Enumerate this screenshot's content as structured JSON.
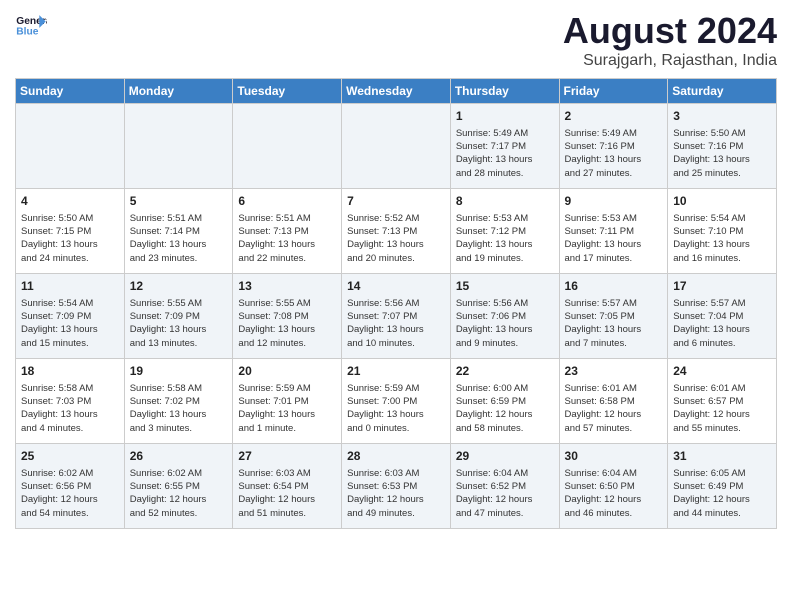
{
  "logo": {
    "line1": "General",
    "line2": "Blue"
  },
  "title": "August 2024",
  "subtitle": "Surajgarh, Rajasthan, India",
  "days_of_week": [
    "Sunday",
    "Monday",
    "Tuesday",
    "Wednesday",
    "Thursday",
    "Friday",
    "Saturday"
  ],
  "weeks": [
    [
      {
        "day": "",
        "info": ""
      },
      {
        "day": "",
        "info": ""
      },
      {
        "day": "",
        "info": ""
      },
      {
        "day": "",
        "info": ""
      },
      {
        "day": "1",
        "info": "Sunrise: 5:49 AM\nSunset: 7:17 PM\nDaylight: 13 hours\nand 28 minutes."
      },
      {
        "day": "2",
        "info": "Sunrise: 5:49 AM\nSunset: 7:16 PM\nDaylight: 13 hours\nand 27 minutes."
      },
      {
        "day": "3",
        "info": "Sunrise: 5:50 AM\nSunset: 7:16 PM\nDaylight: 13 hours\nand 25 minutes."
      }
    ],
    [
      {
        "day": "4",
        "info": "Sunrise: 5:50 AM\nSunset: 7:15 PM\nDaylight: 13 hours\nand 24 minutes."
      },
      {
        "day": "5",
        "info": "Sunrise: 5:51 AM\nSunset: 7:14 PM\nDaylight: 13 hours\nand 23 minutes."
      },
      {
        "day": "6",
        "info": "Sunrise: 5:51 AM\nSunset: 7:13 PM\nDaylight: 13 hours\nand 22 minutes."
      },
      {
        "day": "7",
        "info": "Sunrise: 5:52 AM\nSunset: 7:13 PM\nDaylight: 13 hours\nand 20 minutes."
      },
      {
        "day": "8",
        "info": "Sunrise: 5:53 AM\nSunset: 7:12 PM\nDaylight: 13 hours\nand 19 minutes."
      },
      {
        "day": "9",
        "info": "Sunrise: 5:53 AM\nSunset: 7:11 PM\nDaylight: 13 hours\nand 17 minutes."
      },
      {
        "day": "10",
        "info": "Sunrise: 5:54 AM\nSunset: 7:10 PM\nDaylight: 13 hours\nand 16 minutes."
      }
    ],
    [
      {
        "day": "11",
        "info": "Sunrise: 5:54 AM\nSunset: 7:09 PM\nDaylight: 13 hours\nand 15 minutes."
      },
      {
        "day": "12",
        "info": "Sunrise: 5:55 AM\nSunset: 7:09 PM\nDaylight: 13 hours\nand 13 minutes."
      },
      {
        "day": "13",
        "info": "Sunrise: 5:55 AM\nSunset: 7:08 PM\nDaylight: 13 hours\nand 12 minutes."
      },
      {
        "day": "14",
        "info": "Sunrise: 5:56 AM\nSunset: 7:07 PM\nDaylight: 13 hours\nand 10 minutes."
      },
      {
        "day": "15",
        "info": "Sunrise: 5:56 AM\nSunset: 7:06 PM\nDaylight: 13 hours\nand 9 minutes."
      },
      {
        "day": "16",
        "info": "Sunrise: 5:57 AM\nSunset: 7:05 PM\nDaylight: 13 hours\nand 7 minutes."
      },
      {
        "day": "17",
        "info": "Sunrise: 5:57 AM\nSunset: 7:04 PM\nDaylight: 13 hours\nand 6 minutes."
      }
    ],
    [
      {
        "day": "18",
        "info": "Sunrise: 5:58 AM\nSunset: 7:03 PM\nDaylight: 13 hours\nand 4 minutes."
      },
      {
        "day": "19",
        "info": "Sunrise: 5:58 AM\nSunset: 7:02 PM\nDaylight: 13 hours\nand 3 minutes."
      },
      {
        "day": "20",
        "info": "Sunrise: 5:59 AM\nSunset: 7:01 PM\nDaylight: 13 hours\nand 1 minute."
      },
      {
        "day": "21",
        "info": "Sunrise: 5:59 AM\nSunset: 7:00 PM\nDaylight: 13 hours\nand 0 minutes."
      },
      {
        "day": "22",
        "info": "Sunrise: 6:00 AM\nSunset: 6:59 PM\nDaylight: 12 hours\nand 58 minutes."
      },
      {
        "day": "23",
        "info": "Sunrise: 6:01 AM\nSunset: 6:58 PM\nDaylight: 12 hours\nand 57 minutes."
      },
      {
        "day": "24",
        "info": "Sunrise: 6:01 AM\nSunset: 6:57 PM\nDaylight: 12 hours\nand 55 minutes."
      }
    ],
    [
      {
        "day": "25",
        "info": "Sunrise: 6:02 AM\nSunset: 6:56 PM\nDaylight: 12 hours\nand 54 minutes."
      },
      {
        "day": "26",
        "info": "Sunrise: 6:02 AM\nSunset: 6:55 PM\nDaylight: 12 hours\nand 52 minutes."
      },
      {
        "day": "27",
        "info": "Sunrise: 6:03 AM\nSunset: 6:54 PM\nDaylight: 12 hours\nand 51 minutes."
      },
      {
        "day": "28",
        "info": "Sunrise: 6:03 AM\nSunset: 6:53 PM\nDaylight: 12 hours\nand 49 minutes."
      },
      {
        "day": "29",
        "info": "Sunrise: 6:04 AM\nSunset: 6:52 PM\nDaylight: 12 hours\nand 47 minutes."
      },
      {
        "day": "30",
        "info": "Sunrise: 6:04 AM\nSunset: 6:50 PM\nDaylight: 12 hours\nand 46 minutes."
      },
      {
        "day": "31",
        "info": "Sunrise: 6:05 AM\nSunset: 6:49 PM\nDaylight: 12 hours\nand 44 minutes."
      }
    ]
  ]
}
